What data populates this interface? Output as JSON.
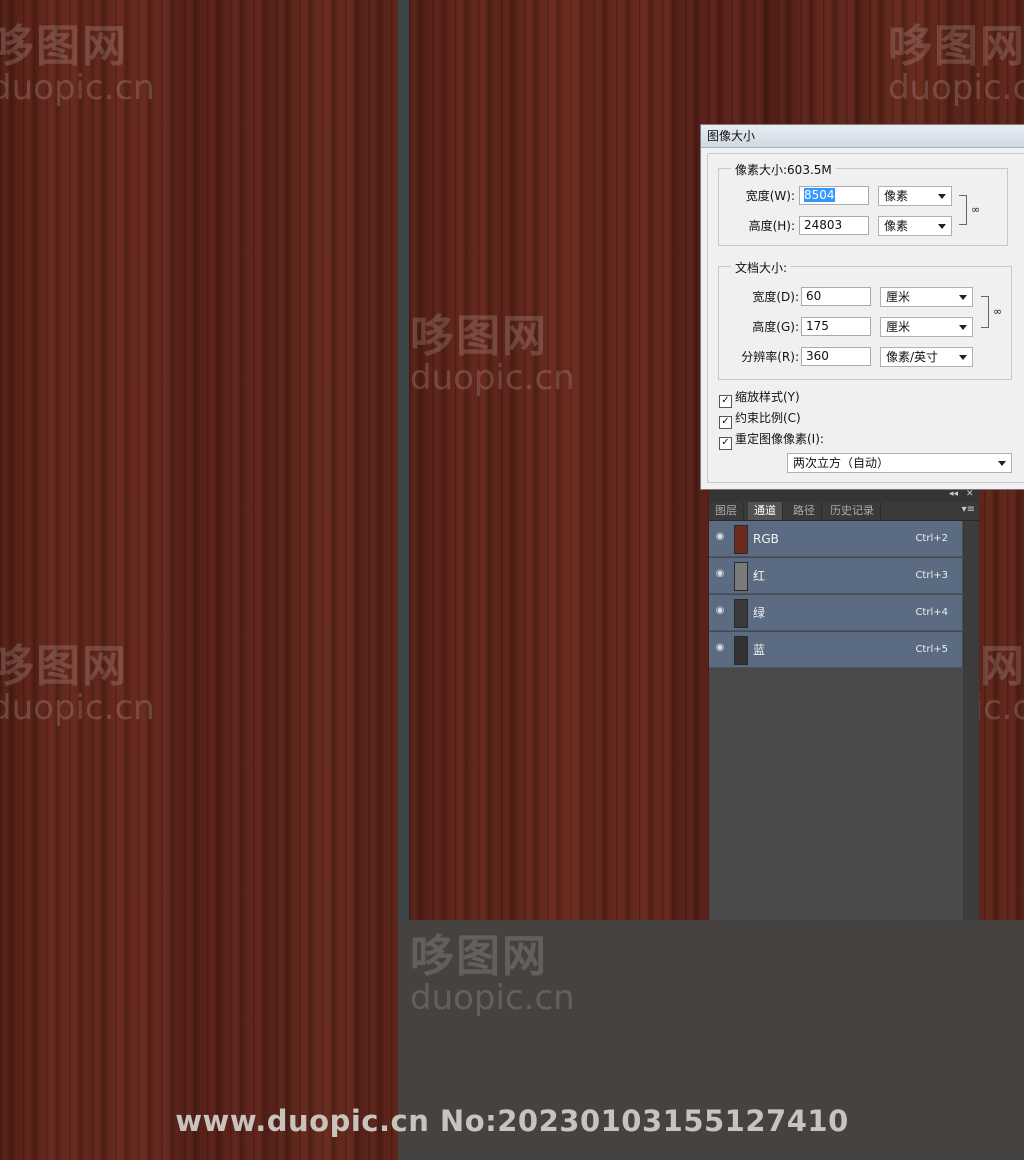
{
  "watermark": {
    "cn": "哆图网",
    "en": "duopic.cn"
  },
  "dialog": {
    "title": "图像大小",
    "pixel_group": {
      "legend": "像素大小:603.5M",
      "width_label": "宽度(W):",
      "width_value": "8504",
      "width_unit": "像素",
      "height_label": "高度(H):",
      "height_value": "24803",
      "height_unit": "像素"
    },
    "doc_group": {
      "legend": "文档大小:",
      "width_label": "宽度(D):",
      "width_value": "60",
      "width_unit": "厘米",
      "height_label": "高度(G):",
      "height_value": "175",
      "height_unit": "厘米",
      "res_label": "分辨率(R):",
      "res_value": "360",
      "res_unit": "像素/英寸"
    },
    "options": {
      "scale_styles": "缩放样式(Y)",
      "constrain": "约束比例(C)",
      "resample": "重定图像像素(I):",
      "method": "两次立方（自动）"
    }
  },
  "panel": {
    "collapse": "◂◂",
    "close": "✕",
    "menu": "▾≡",
    "tabs": [
      "图层",
      "通道",
      "路径",
      "历史记录"
    ],
    "channels": [
      {
        "name": "RGB",
        "shortcut": "Ctrl+2",
        "thumb": "#6b2a20"
      },
      {
        "name": "红",
        "shortcut": "Ctrl+3",
        "thumb": "#7a7a7a"
      },
      {
        "name": "绿",
        "shortcut": "Ctrl+4",
        "thumb": "#3a3a3a"
      },
      {
        "name": "蓝",
        "shortcut": "Ctrl+5",
        "thumb": "#333333"
      }
    ]
  },
  "footer": "www.duopic.cn No:20230103155127410"
}
